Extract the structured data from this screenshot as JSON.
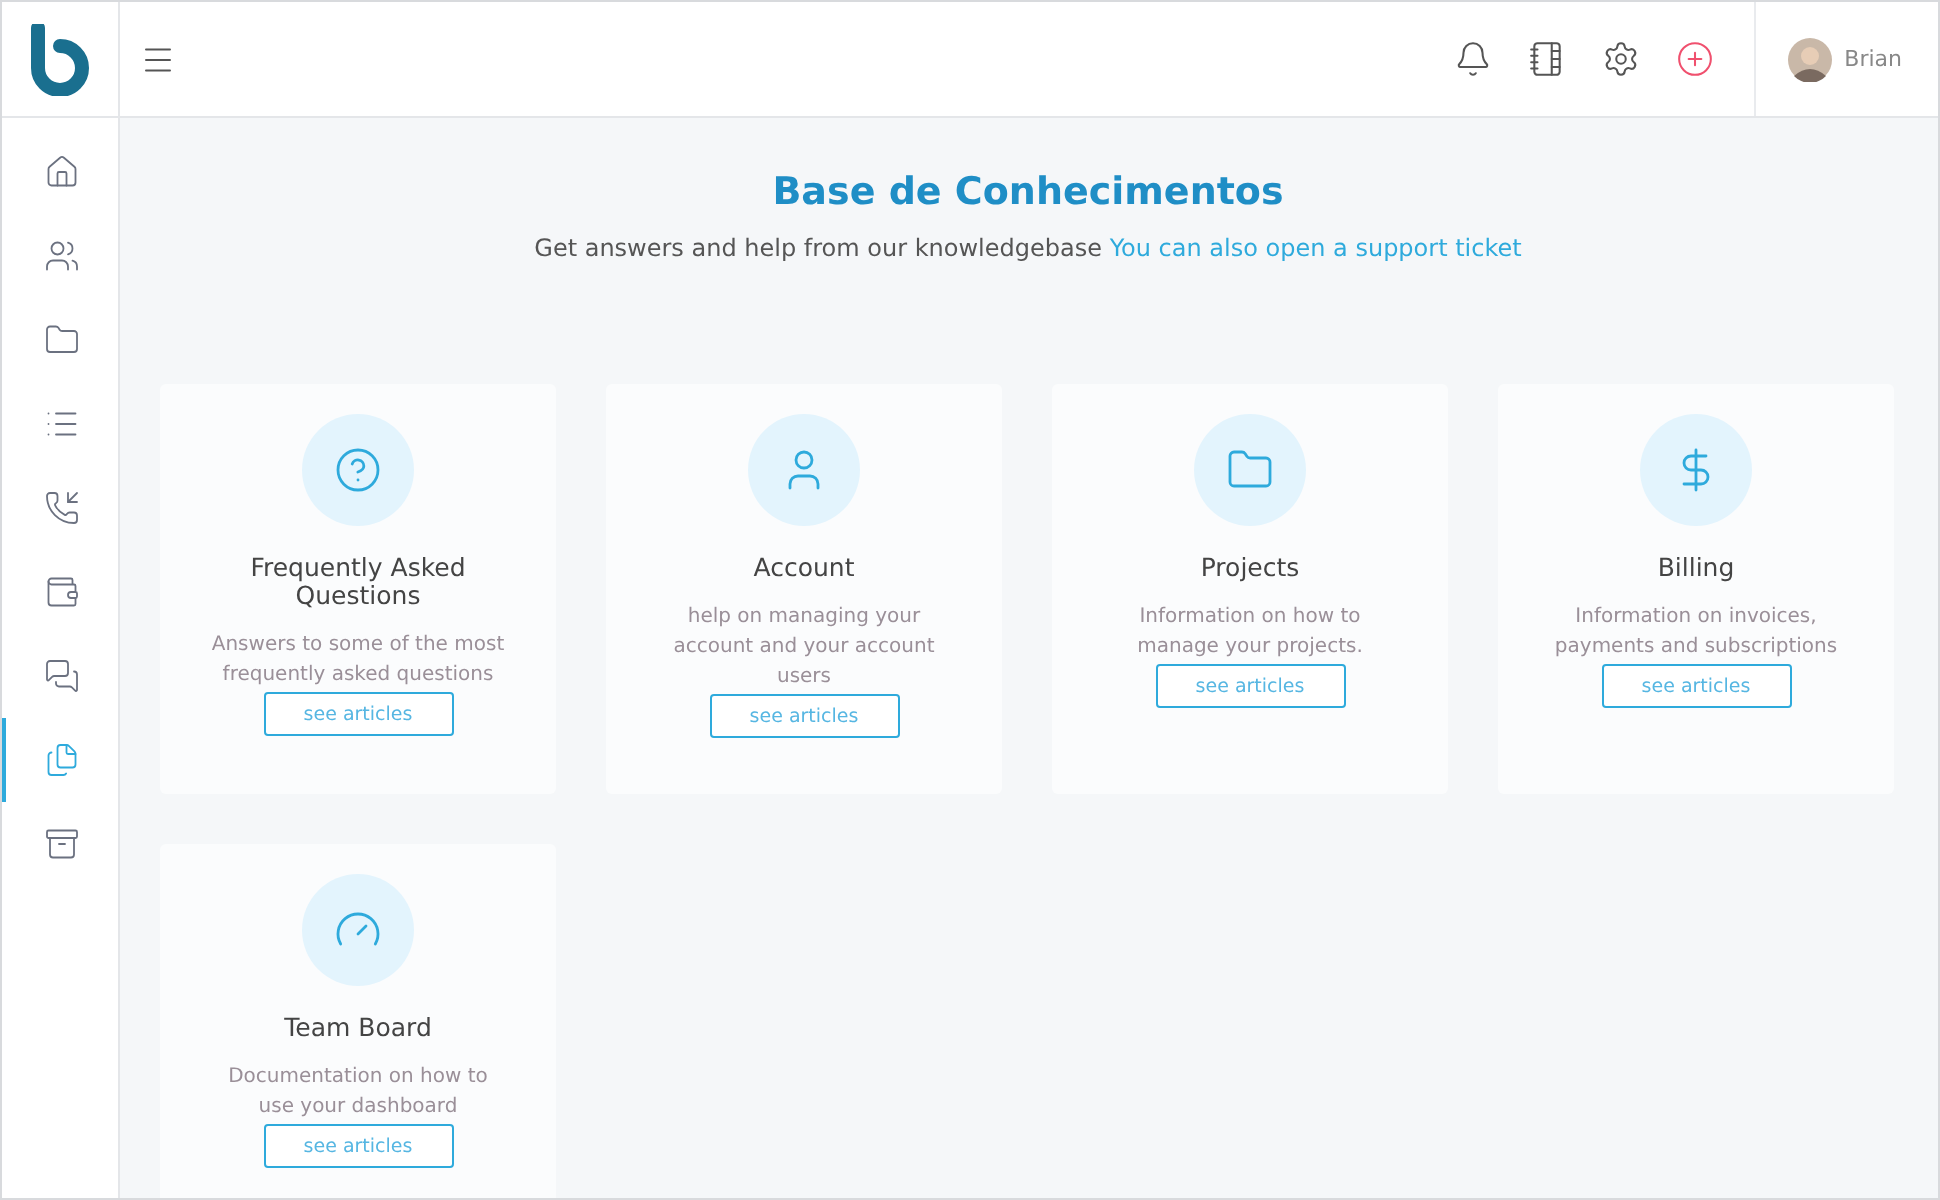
{
  "topbar": {
    "user": {
      "name": "Brian"
    },
    "icons": [
      {
        "kind": "bell"
      },
      {
        "kind": "notebook"
      },
      {
        "kind": "settings"
      },
      {
        "kind": "add"
      }
    ]
  },
  "sidebar": {
    "items": [
      {
        "kind": "home",
        "selected": false
      },
      {
        "kind": "contacts",
        "selected": false
      },
      {
        "kind": "folder",
        "selected": false
      },
      {
        "kind": "list",
        "selected": false
      },
      {
        "kind": "phone",
        "selected": false
      },
      {
        "kind": "wallet",
        "selected": false
      },
      {
        "kind": "chat",
        "selected": false
      },
      {
        "kind": "files",
        "selected": true
      },
      {
        "kind": "archive",
        "selected": false
      }
    ]
  },
  "header": {
    "title": "Base de Conhecimentos",
    "subtitle": "Get answers and help from our knowledgebase",
    "link": "You can also open a support ticket"
  },
  "categories": [
    {
      "kind": "question",
      "title": "Frequently Asked Questions",
      "description": "Answers to some of the most frequently asked questions",
      "button": "see articles"
    },
    {
      "kind": "user",
      "title": "Account",
      "description": "help on managing your account and your account users",
      "button": "see articles"
    },
    {
      "kind": "folder",
      "title": "Projects",
      "description": "Information on how to manage your projects.",
      "button": "see articles"
    },
    {
      "kind": "dollar",
      "title": "Billing",
      "description": "Information on invoices, payments and subscriptions",
      "button": "see articles"
    },
    {
      "kind": "gauge",
      "title": "Team Board",
      "description": "Documentation on how to use your dashboard",
      "button": "see articles"
    }
  ]
}
